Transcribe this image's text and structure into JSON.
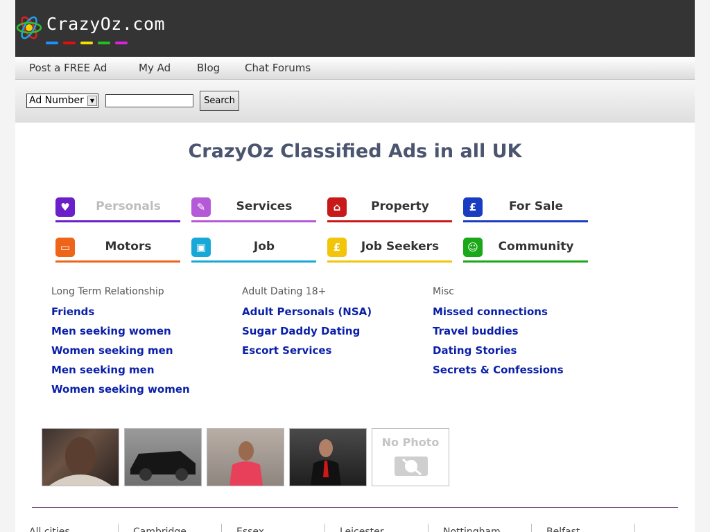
{
  "header": {
    "logo_text": "CrazyOz.com",
    "dash_colors": [
      "#1e90ff",
      "#e01010",
      "#f5e000",
      "#20c020",
      "#e020e0"
    ]
  },
  "nav": {
    "items": [
      "Post a FREE Ad",
      "My Ad",
      "Blog",
      "Chat Forums"
    ]
  },
  "search": {
    "select_value": "Ad Number",
    "input_value": "",
    "button_label": "Search"
  },
  "page_title": "CrazyOz Classified Ads in all UK",
  "categories": [
    {
      "label": "Personals",
      "icon": "heart-icon",
      "color": "#6a1fc8",
      "active": true
    },
    {
      "label": "Services",
      "icon": "wrench-icon",
      "color": "#b45ad8"
    },
    {
      "label": "Property",
      "icon": "house-icon",
      "color": "#c81818"
    },
    {
      "label": "For Sale",
      "icon": "pound-badge-icon",
      "color": "#1a3cc0"
    },
    {
      "label": "Motors",
      "icon": "car-icon",
      "color": "#ee6418"
    },
    {
      "label": "Job",
      "icon": "briefcase-icon",
      "color": "#18a8d8"
    },
    {
      "label": "Job Seekers",
      "icon": "money-bag-icon",
      "color": "#f2c40a"
    },
    {
      "label": "Community",
      "icon": "smiley-icon",
      "color": "#1aa818"
    }
  ],
  "columns": [
    {
      "heading": "Long Term Relationship",
      "links": [
        "Friends",
        "Men seeking women",
        "Women seeking men",
        "Men seeking men",
        "Women seeking women"
      ]
    },
    {
      "heading": "Adult Dating 18+",
      "links": [
        "Adult Personals (NSA)",
        "Sugar Daddy Dating",
        "Escort Services"
      ]
    },
    {
      "heading": "Misc",
      "links": [
        "Missed connections",
        "Travel buddies",
        "Dating Stories",
        "Secrets & Confessions"
      ]
    }
  ],
  "thumbnails": {
    "no_photo_label": "No Photo"
  },
  "locations": [
    "All cities",
    "Cambridge",
    "Essex",
    "Leicester",
    "Nottingham",
    "Belfast"
  ]
}
